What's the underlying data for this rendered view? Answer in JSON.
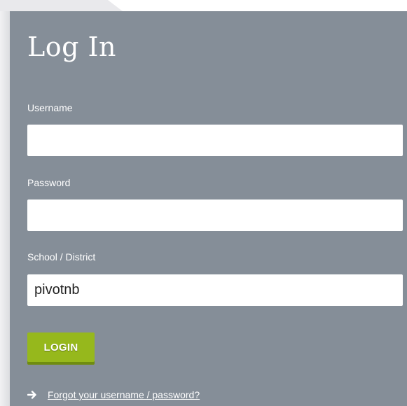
{
  "login_form": {
    "title": "Log In",
    "username": {
      "label": "Username",
      "value": "",
      "placeholder": ""
    },
    "password": {
      "label": "Password",
      "value": "",
      "placeholder": ""
    },
    "school_district": {
      "label": "School / District",
      "value": "pivotnb",
      "placeholder": ""
    },
    "login_button_label": "LOGIN",
    "forgot_link_label": "Forgot your username / password?",
    "forgot_icon": "arrow-right-icon"
  },
  "colors": {
    "panel_background": "#858e98",
    "button_green": "#96b81c",
    "text": "#ffffff"
  }
}
